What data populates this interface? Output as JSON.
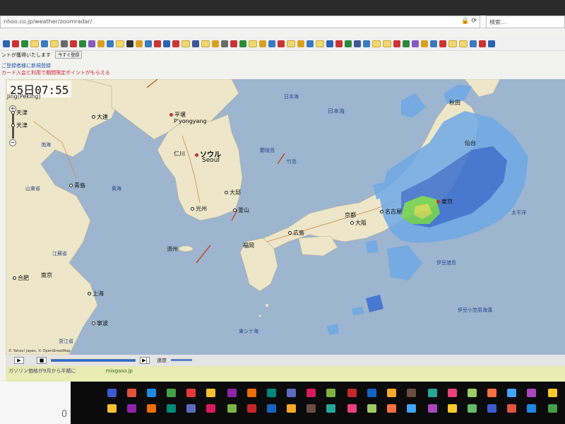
{
  "browser": {
    "url": "nhoo.co.jp/weather/zoomradar/",
    "search_placeholder": "検索..."
  },
  "notice": {
    "text": "ントが獲得いたします",
    "button": "今すぐ登録"
  },
  "promo": {
    "line1": "ご登録者様に新規登録",
    "line2": "カード入会と利用で期間限定ポイントがもらえる"
  },
  "map": {
    "time": "25日07:55",
    "time_sub": "Jing(Peking)",
    "copyright": "© Yahoo! Japan, © OpenStreetMap",
    "cities": [
      {
        "id": "dalian",
        "label": "大連"
      },
      {
        "id": "pyongyang-jp",
        "label": "平壌"
      },
      {
        "id": "pyongyang",
        "label": "P'yongyang"
      },
      {
        "id": "seoul-jp",
        "label": "ソウル"
      },
      {
        "id": "seoul",
        "label": "Seoul"
      },
      {
        "id": "incheon",
        "label": "仁川"
      },
      {
        "id": "qingdao",
        "label": "青島"
      },
      {
        "id": "daegu",
        "label": "大邱"
      },
      {
        "id": "busan",
        "label": "釜山"
      },
      {
        "id": "gwangju",
        "label": "光州"
      },
      {
        "id": "jeju",
        "label": "済州"
      },
      {
        "id": "shanghai",
        "label": "上海"
      },
      {
        "id": "hefei",
        "label": "合肥"
      },
      {
        "id": "nanjing",
        "label": "南京"
      },
      {
        "id": "ningbo",
        "label": "寧波"
      },
      {
        "id": "fukuoka",
        "label": "福岡"
      },
      {
        "id": "hiroshima",
        "label": "広島"
      },
      {
        "id": "kyoto",
        "label": "京都"
      },
      {
        "id": "osaka",
        "label": "大阪"
      },
      {
        "id": "nagoya",
        "label": "名古屋"
      },
      {
        "id": "tokyo",
        "label": "東京"
      },
      {
        "id": "sendai",
        "label": "仙台"
      },
      {
        "id": "akita",
        "label": "秋田"
      },
      {
        "id": "tianjin",
        "label": "天津"
      },
      {
        "id": "tianjin2",
        "label": "天津"
      }
    ],
    "seas": [
      {
        "id": "japan-sea",
        "label": "日本海"
      },
      {
        "id": "japan-sea-2",
        "label": "日本海"
      },
      {
        "id": "yellow-sea",
        "label": "黄海"
      },
      {
        "id": "pacific",
        "label": "太平洋"
      },
      {
        "id": "east-china-sea",
        "label": "東シナ海"
      },
      {
        "id": "izu",
        "label": "伊豆諸島"
      },
      {
        "id": "izu-trench",
        "label": "伊豆小笠原海溝"
      },
      {
        "id": "bohai",
        "label": "渤海"
      },
      {
        "id": "jiangsu",
        "label": "江蘇省"
      },
      {
        "id": "zhejiang",
        "label": "浙江省"
      },
      {
        "id": "shandong",
        "label": "山東省"
      },
      {
        "id": "ulleung",
        "label": "鬱陵島"
      },
      {
        "id": "oki",
        "label": "竹島"
      }
    ]
  },
  "player": {
    "play": "▶",
    "stop": "■",
    "forward": "▶|",
    "speed_label": "速度"
  },
  "bottom": {
    "line1": "ガソリン価格が9月から半額に",
    "line2": "mixgaso.jp"
  },
  "colors": {
    "land": "#ede6c8",
    "sea": "#9db5cf",
    "rain_light": "#6fa9e6",
    "rain_mid": "#3a6fd0",
    "rain_heavy": "#6ed04a"
  }
}
